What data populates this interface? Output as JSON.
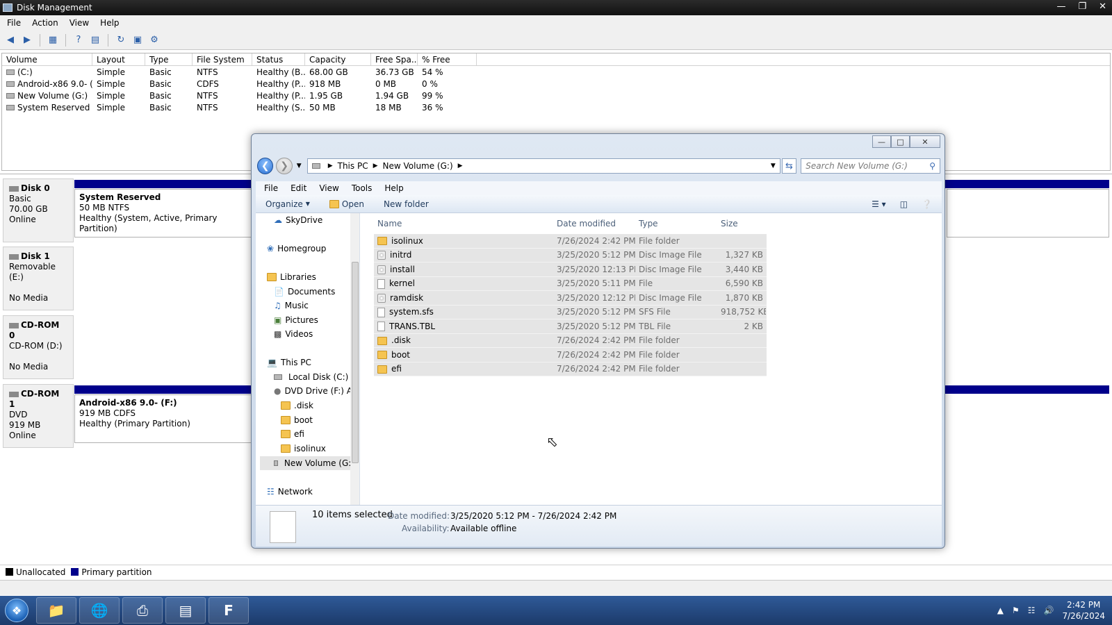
{
  "dm": {
    "title": "Disk Management",
    "menu": [
      "File",
      "Action",
      "View",
      "Help"
    ],
    "columns": [
      "Volume",
      "Layout",
      "Type",
      "File System",
      "Status",
      "Capacity",
      "Free Spa...",
      "% Free"
    ],
    "volumes": [
      [
        "(C:)",
        "Simple",
        "Basic",
        "NTFS",
        "Healthy (B...",
        "68.00 GB",
        "36.73 GB",
        "54 %"
      ],
      [
        "Android-x86 9.0- (...",
        "Simple",
        "Basic",
        "CDFS",
        "Healthy (P...",
        "918 MB",
        "0 MB",
        "0 %"
      ],
      [
        "New Volume (G:)",
        "Simple",
        "Basic",
        "NTFS",
        "Healthy (P...",
        "1.95 GB",
        "1.94 GB",
        "99 %"
      ],
      [
        "System Reserved",
        "Simple",
        "Basic",
        "NTFS",
        "Healthy (S...",
        "50 MB",
        "18 MB",
        "36 %"
      ]
    ],
    "disks": [
      {
        "name": "Disk 0",
        "l1": "Basic",
        "l2": "70.00 GB",
        "l3": "Online",
        "part_title": "System Reserved",
        "part_l1": "50 MB NTFS",
        "part_l2": "Healthy (System, Active, Primary Partition)"
      },
      {
        "name": "Disk 1",
        "l1": "Removable (E:)",
        "l2": "",
        "l3": "No Media"
      },
      {
        "name": "CD-ROM 0",
        "l1": "CD-ROM (D:)",
        "l2": "",
        "l3": "No Media"
      },
      {
        "name": "CD-ROM 1",
        "l1": "DVD",
        "l2": "919 MB",
        "l3": "Online",
        "part_title": "Android-x86 9.0-  (F:)",
        "part_l1": "919 MB CDFS",
        "part_l2": "Healthy (Primary Partition)"
      }
    ],
    "legend": {
      "unallocated": "Unallocated",
      "primary": "Primary partition"
    },
    "colors": {
      "unallocated": "#000000",
      "primary": "#00008b"
    }
  },
  "explorer": {
    "breadcrumb": [
      "This PC",
      "New Volume (G:)"
    ],
    "search_placeholder": "Search New Volume (G:)",
    "menu": [
      "File",
      "Edit",
      "View",
      "Tools",
      "Help"
    ],
    "cmd": {
      "organize": "Organize",
      "open": "Open",
      "new_folder": "New folder"
    },
    "nav": {
      "skydrive": "SkyDrive",
      "homegroup": "Homegroup",
      "libraries": "Libraries",
      "documents": "Documents",
      "music": "Music",
      "pictures": "Pictures",
      "videos": "Videos",
      "this_pc": "This PC",
      "local_disk": "Local Disk (C:)",
      "dvd_drive": "DVD Drive (F:) Ar",
      "disk": ".disk",
      "boot": "boot",
      "efi": "efi",
      "isolinux": "isolinux",
      "new_volume": "New Volume (G:)",
      "network": "Network"
    },
    "columns": {
      "name": "Name",
      "date": "Date modified",
      "type": "Type",
      "size": "Size"
    },
    "files": [
      {
        "name": "isolinux",
        "date": "7/26/2024 2:42 PM",
        "type": "File folder",
        "size": "",
        "icon": "folder"
      },
      {
        "name": "initrd",
        "date": "3/25/2020 5:12 PM",
        "type": "Disc Image File",
        "size": "1,327 KB",
        "icon": "disc"
      },
      {
        "name": "install",
        "date": "3/25/2020 12:13 PM",
        "type": "Disc Image File",
        "size": "3,440 KB",
        "icon": "disc"
      },
      {
        "name": "kernel",
        "date": "3/25/2020 5:11 PM",
        "type": "File",
        "size": "6,590 KB",
        "icon": "file"
      },
      {
        "name": "ramdisk",
        "date": "3/25/2020 12:12 PM",
        "type": "Disc Image File",
        "size": "1,870 KB",
        "icon": "disc"
      },
      {
        "name": "system.sfs",
        "date": "3/25/2020 5:12 PM",
        "type": "SFS File",
        "size": "918,752 KB",
        "icon": "file"
      },
      {
        "name": "TRANS.TBL",
        "date": "3/25/2020 5:12 PM",
        "type": "TBL File",
        "size": "2 KB",
        "icon": "file"
      },
      {
        "name": ".disk",
        "date": "7/26/2024 2:42 PM",
        "type": "File folder",
        "size": "",
        "icon": "folder"
      },
      {
        "name": "boot",
        "date": "7/26/2024 2:42 PM",
        "type": "File folder",
        "size": "",
        "icon": "folder"
      },
      {
        "name": "efi",
        "date": "7/26/2024 2:42 PM",
        "type": "File folder",
        "size": "",
        "icon": "folder"
      }
    ],
    "details": {
      "selected": "10 items selected",
      "date_label": "Date modified:",
      "date_value": "3/25/2020 5:12 PM - 7/26/2024 2:42 PM",
      "avail_label": "Availability:",
      "avail_value": "Available offline"
    }
  },
  "taskbar": {
    "time": "2:42 PM",
    "date": "7/26/2024"
  }
}
